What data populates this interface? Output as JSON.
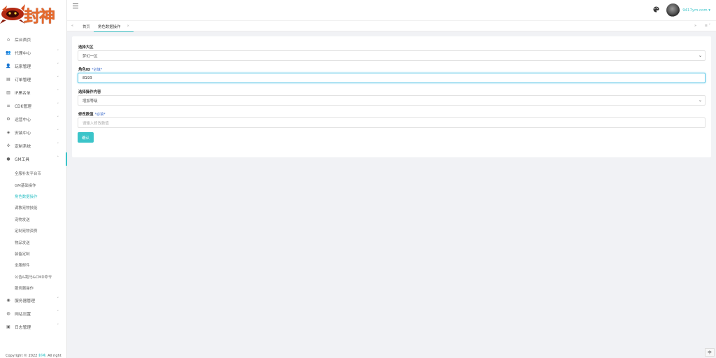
{
  "logo": {
    "text": "封神"
  },
  "sidebar": {
    "items": [
      {
        "label": "后台首页",
        "icon": "home-icon",
        "glyph": "⌂",
        "arrow": ""
      },
      {
        "label": "代理中心",
        "icon": "users-icon",
        "glyph": "👥",
        "arrow": "˅"
      },
      {
        "label": "玩家管理",
        "icon": "user-group-icon",
        "glyph": "👤",
        "arrow": "˅"
      },
      {
        "label": "订单管理",
        "icon": "order-icon",
        "glyph": "▤",
        "arrow": "˅"
      },
      {
        "label": "IP黑名单",
        "icon": "blacklist-icon",
        "glyph": "▥",
        "arrow": "˅"
      },
      {
        "label": "CDK管理",
        "icon": "list-icon",
        "glyph": "≡",
        "arrow": "˅"
      },
      {
        "label": "运营中心",
        "icon": "gear-icon",
        "glyph": "⚙",
        "arrow": "˅"
      },
      {
        "label": "安装中心",
        "icon": "shield-icon",
        "glyph": "◈",
        "arrow": "˅"
      },
      {
        "label": "定制系统",
        "icon": "puzzle-icon",
        "glyph": "✣",
        "arrow": "˅"
      },
      {
        "label": "GM工具",
        "icon": "bulb-icon",
        "glyph": "●",
        "arrow": "˄"
      }
    ],
    "gm_subitems": [
      "全服补发平台币",
      "GM基础操作",
      "角色数据操作",
      "调教宠物技能",
      "宠物发送",
      "定制宠物资质",
      "物品发送",
      "装备定制",
      "全服邮件",
      "公告&跑马&CMD命令",
      "服务器操作"
    ],
    "bottom_items": [
      {
        "label": "服务器管理",
        "icon": "wifi-icon",
        "glyph": "◉",
        "arrow": "˅"
      },
      {
        "label": "网站设置",
        "icon": "globe-icon",
        "glyph": "◍",
        "arrow": "˅"
      },
      {
        "label": "日志管理",
        "icon": "log-icon",
        "glyph": "▣",
        "arrow": "˅"
      }
    ],
    "copyright_prefix": "Copyright © 2022 ",
    "copyright_brand": "封神",
    "copyright_suffix": ". All right"
  },
  "header": {
    "username": "9417ym.com ▾"
  },
  "tabs": {
    "prev": "«",
    "home": "首页",
    "current": "角色数据操作",
    "close": "×",
    "next": "»",
    "menu": "≡ ˅"
  },
  "form": {
    "server_label": "选择大区",
    "server_value": "梦幻一区",
    "role_id_label": "角色ID",
    "role_id_req": "*必填*",
    "role_id_value": "8193",
    "op_label": "选择操作内容",
    "op_value": "增加等级",
    "value_label": "修改数值",
    "value_req": "*必填*",
    "value_placeholder": "请输入修改数值",
    "confirm_label": "确认"
  },
  "lang_toggle": "中",
  "colors": {
    "accent": "#3bc4c9",
    "required": "#3f6dcc"
  }
}
